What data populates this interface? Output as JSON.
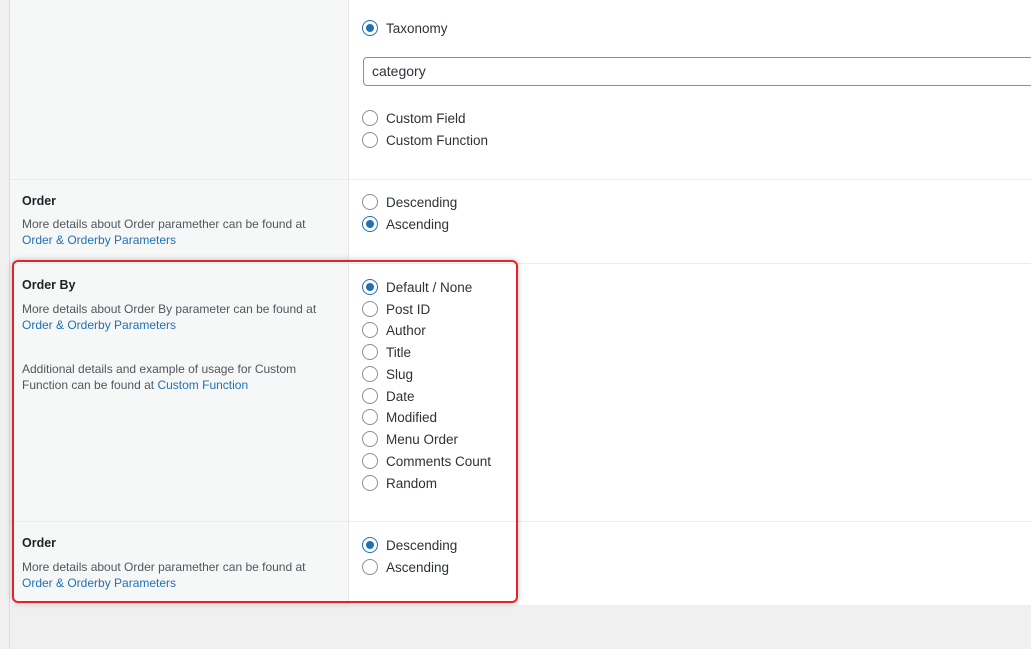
{
  "sort_section": {
    "taxonomy_option": "Taxonomy",
    "taxonomy_value": "category",
    "custom_field_option": "Custom Field",
    "custom_function_option": "Custom Function"
  },
  "order_1": {
    "title": "Order",
    "desc": "More details about Order paramether can be found at",
    "link": "Order & Orderby Parameters",
    "options": [
      "Descending",
      "Ascending"
    ],
    "selected": "Ascending"
  },
  "order_by": {
    "title": "Order By",
    "desc": "More details about Order By parameter can be found at",
    "link": "Order & Orderby Parameters",
    "extra_desc": "Additional details and example of usage for Custom Function can be found at",
    "extra_link": "Custom Function",
    "options": [
      "Default / None",
      "Post ID",
      "Author",
      "Title",
      "Slug",
      "Date",
      "Modified",
      "Menu Order",
      "Comments Count",
      "Random"
    ],
    "selected": "Default / None"
  },
  "order_2": {
    "title": "Order",
    "desc": "More details about Order paramether can be found at",
    "link": "Order & Orderby Parameters",
    "options": [
      "Descending",
      "Ascending"
    ],
    "selected": "Descending"
  },
  "colors": {
    "accent": "#2271b1",
    "highlight": "#e8202a"
  }
}
